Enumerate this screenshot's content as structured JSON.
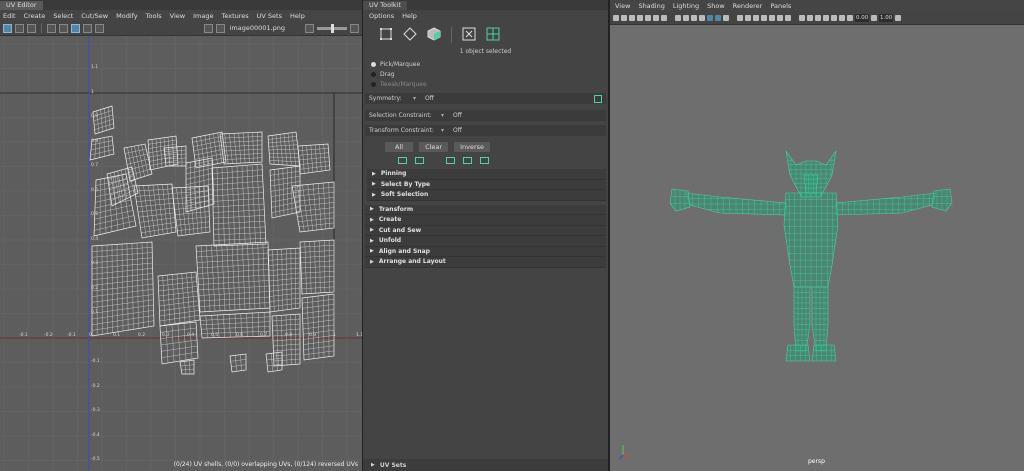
{
  "uv_editor": {
    "tab_title": "UV Editor",
    "menu": [
      "Edit",
      "Create",
      "Select",
      "Cut/Sew",
      "Modify",
      "Tools",
      "View",
      "Image",
      "Textures",
      "UV Sets",
      "Help"
    ],
    "image_name": "image00001.png",
    "status": "(0/24) UV shells, (0/0) overlapping UVs, (0/124) reversed UVs",
    "axis_labels_x": [
      "-0.1",
      "-0.2",
      "-0.1",
      "0",
      "0.1",
      "0.2",
      "0.3",
      "0.4",
      "0.5",
      "0.6",
      "0.7",
      "0.8",
      "0.9",
      "1",
      "1.1"
    ],
    "axis_labels_y": [
      "1.1",
      "1",
      "0.9",
      "0.8",
      "0.7",
      "0.6",
      "0.5",
      "0.4",
      "0.3",
      "0.2",
      "0.1",
      "-0.1",
      "-0.2",
      "-0.3",
      "-0.4",
      "-0.5",
      "-0.6",
      "-0.7"
    ]
  },
  "toolkit": {
    "tab_title": "UV Toolkit",
    "menu": [
      "Options",
      "Help"
    ],
    "selection_count": "1 object selected",
    "modes": [
      {
        "label": "Pick/Marquee",
        "active": true
      },
      {
        "label": "Drag",
        "active": false
      },
      {
        "label": "Tweak/Marquee",
        "active": false
      }
    ],
    "symmetry_label": "Symmetry:",
    "symmetry_value": "Off",
    "selection_constraint_label": "Selection Constraint:",
    "selection_constraint_value": "Off",
    "transform_constraint_label": "Transform Constraint:",
    "transform_constraint_value": "Off",
    "buttons": [
      "All",
      "Clear",
      "Inverse"
    ],
    "subsections": [
      "Pinning",
      "Select By Type",
      "Soft Selection"
    ],
    "sections": [
      "Transform",
      "Create",
      "Cut and Sew",
      "Unfold",
      "Align and Snap",
      "Arrange and Layout"
    ],
    "uv_sets": "UV Sets"
  },
  "viewport": {
    "menu": [
      "View",
      "Shading",
      "Lighting",
      "Show",
      "Renderer",
      "Panels"
    ],
    "field_a": "0.00",
    "field_b": "1.00",
    "camera_label": "persp",
    "accent_color": "#4fd1a0"
  }
}
